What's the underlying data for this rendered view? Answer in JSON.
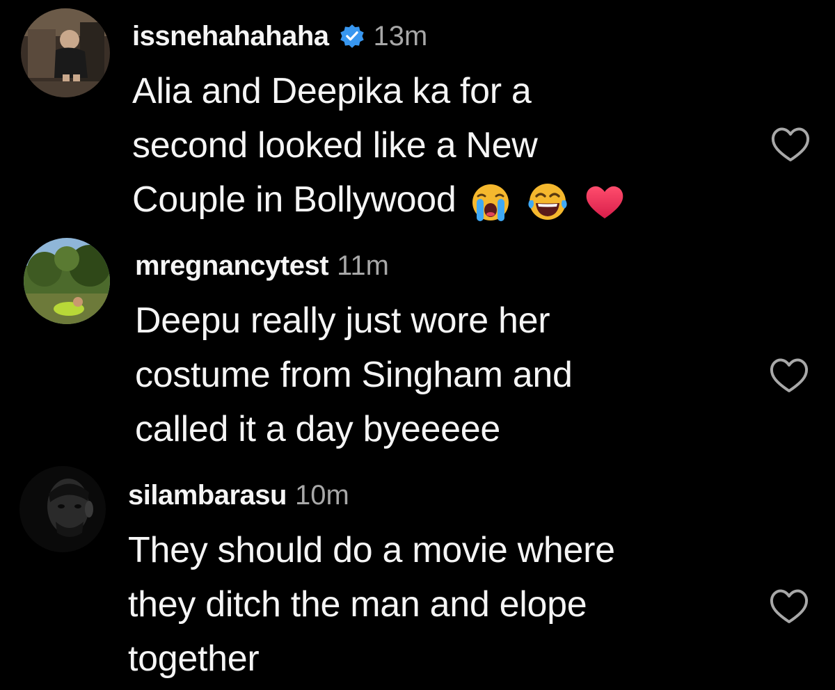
{
  "colors": {
    "background": "#000000",
    "text_primary": "#f5f5f5",
    "text_secondary": "#a8a8a8",
    "verified_badge": "#3897f0"
  },
  "comments": [
    {
      "username": "issnehahahaha",
      "verified": true,
      "time": "13m",
      "lines": [
        "Alia and Deepika ka for a",
        "second looked like a New",
        "Couple in Bollywood"
      ],
      "emojis": [
        "loudly-crying-face-icon",
        "face-with-tears-of-joy-icon",
        "red-heart-icon"
      ],
      "like_icon": "heart-outline-icon"
    },
    {
      "username": "mregnancytest",
      "verified": false,
      "time": "11m",
      "lines": [
        "Deepu really just wore her",
        "costume from Singham and",
        "called it a day byeeeee"
      ],
      "like_icon": "heart-outline-icon"
    },
    {
      "username": "silambarasu",
      "verified": false,
      "time": "10m",
      "lines": [
        "They should do a movie where",
        "they ditch the man and elope",
        "together"
      ],
      "like_icon": "heart-outline-icon"
    }
  ]
}
